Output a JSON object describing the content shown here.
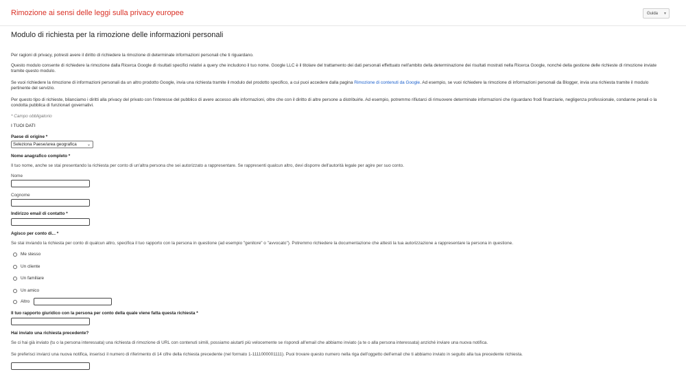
{
  "header": {
    "title": "Rimozione ai sensi delle leggi sulla privacy europee",
    "help_label": "Guida"
  },
  "form": {
    "title": "Modulo di richiesta per la rimozione delle informazioni personali",
    "intro": [
      "Per ragioni di privacy, potresti avere il diritto di richiedere la rimozione di determinate informazioni personali che ti riguardano.",
      "Questo modulo consente di richiedere la rimozione dalla Ricerca Google di risultati specifici relativi a query che includono il tuo nome. Google LLC è il titolare del trattamento dei dati personali effettuato nell'ambito della determinazione dei risultati mostrati nella Ricerca Google, nonché della gestione delle richieste di rimozione inviate tramite questo modulo.",
      {
        "before": "Se vuoi richiedere la rimozione di informazioni personali da un altro prodotto Google, invia una richiesta tramite il modulo del prodotto specifico, a cui puoi accedere dalla pagina ",
        "link": "Rimozione di contenuti da Google",
        "after": ". Ad esempio, se vuoi richiedere la rimozione di informazioni personali da Blogger, invia una richiesta tramite il modulo pertinente del servizio."
      },
      "Per questo tipo di richieste, bilanciamo i diritti alla privacy del privato con l'interesse del pubblico di avere accesso alle informazioni, oltre che con il diritto di altre persone a distribuirle. Ad esempio, potremmo rifiutarci di rimuovere determinate informazioni che riguardano frodi finanziarie, negligenza professionale, condanne penali o la condotta pubblica di funzionari governativi."
    ],
    "required_note": "* Campo obbligatorio",
    "section_title": "I tuoi dati",
    "country": {
      "label": "Paese di origine *",
      "selected": "Seleziona Paese/area geografica"
    },
    "full_name": {
      "label": "Nome anagrafico completo *",
      "help": "Il tuo nome, anche se stai presentando la richiesta per conto di un'altra persona che sei autorizzato a rappresentare. Se rappresenti qualcun altro, devi disporre dell'autorità legale per agire per suo conto.",
      "first_name_label": "Nome",
      "last_name_label": "Cognome"
    },
    "email": {
      "label": "Indirizzo email di contatto *"
    },
    "acting_for": {
      "label": "Agisco per conto di... *",
      "help": "Se stai inviando la richiesta per conto di qualcun altro, specifica il tuo rapporto con la persona in questione (ad esempio \"genitore\" o \"avvocato\"). Potremmo richiedere la documentazione che attesti la tua autorizzazione a rappresentare la persona in questione.",
      "options": [
        "Me stesso",
        "Un cliente",
        "Un familiare",
        "Un amico",
        "Altro"
      ]
    },
    "legal_relationship": {
      "label": "Il tuo rapporto giuridico con la persona per conto della quale viene fatta questa richiesta *"
    },
    "previous_request": {
      "label": "Hai inviato una richiesta precedente?",
      "help1": "Se ci hai già inviato (tu o la persona interessata) una richiesta di rimozione di URL con contenuti simili, possiamo aiutarti più velocemente se rispondi all'email che abbiamo inviato (a te o alla persona interessata) anziché inviare una nuova notifica.",
      "help2": "Se preferisci inviarci una nuova notifica, inserisci il numero di riferimento di 14 cifre della richiesta precedente (nel formato 1-1111000001111). Puoi trovare questo numero nella riga dell'oggetto dell'email che ti abbiamo inviato in seguito alla tua precedente richiesta."
    }
  }
}
